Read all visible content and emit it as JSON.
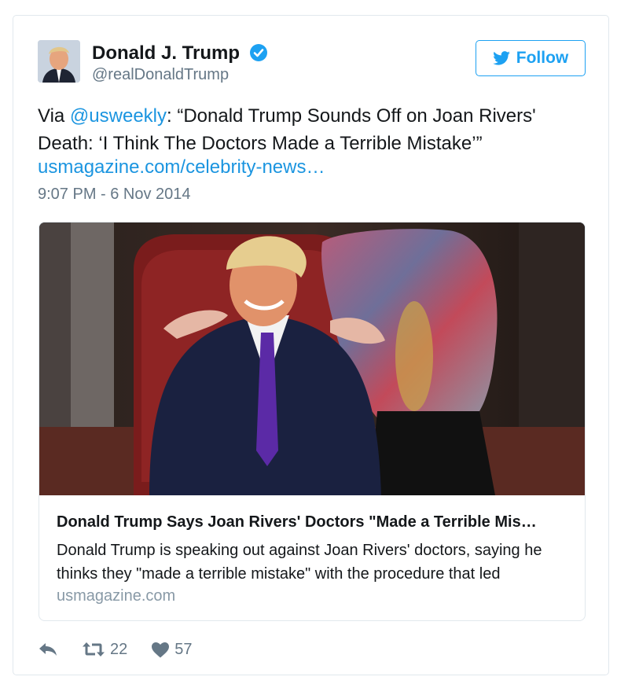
{
  "author": {
    "name": "Donald J. Trump",
    "handle": "@realDonaldTrump",
    "verified": true,
    "avatar_icon": "profile-photo"
  },
  "follow_label": "Follow",
  "tweet": {
    "prefix": "Via ",
    "mention": "@usweekly",
    "body": ": “Donald Trump Sounds Off on Joan Rivers' Death: ‘I Think The Doctors Made a Terrible Mistake’”",
    "link": "usmagazine.com/celebrity-news…",
    "timestamp": "9:07 PM - 6 Nov 2014"
  },
  "card": {
    "title": "Donald Trump Says Joan Rivers' Doctors \"Made a Terrible Mis…",
    "description": "Donald Trump is speaking out against Joan Rivers' doctors, saying he thinks they \"made a terrible mistake\" with the procedure that led",
    "domain": "usmagazine.com"
  },
  "actions": {
    "reply_icon": "reply-icon",
    "retweet_count": "22",
    "like_count": "57"
  },
  "colors": {
    "accent": "#1da1f2",
    "link": "#1b95e0",
    "muted": "#657786"
  }
}
